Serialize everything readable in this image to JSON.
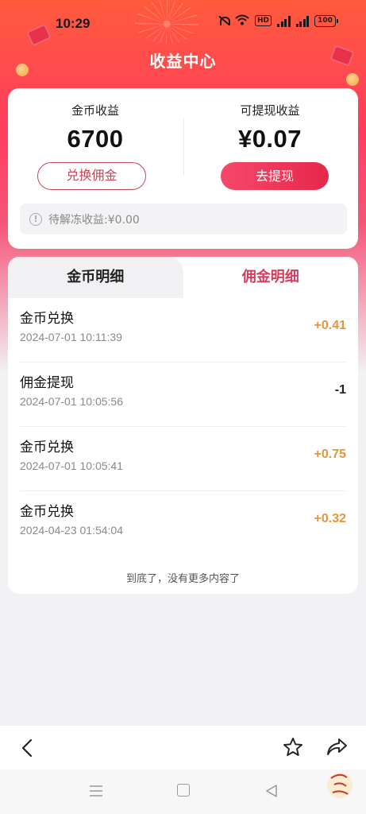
{
  "status_bar": {
    "time": "10:29",
    "battery": "100",
    "hd": "HD"
  },
  "header": {
    "title": "收益中心"
  },
  "earnings": {
    "coins_label": "金币收益",
    "coins_value": "6700",
    "exchange_button": "兑换佣金",
    "withdrawable_label": "可提现收益",
    "withdrawable_value": "¥0.07",
    "withdraw_button": "去提现",
    "frozen_text": "待解冻收益:¥0.00"
  },
  "tabs": [
    {
      "label": "金币明细",
      "active": false
    },
    {
      "label": "佣金明细",
      "active": true
    }
  ],
  "records": [
    {
      "title": "金币兑换",
      "time": "2024-07-01 10:11:39",
      "amount": "+0.41"
    },
    {
      "title": "佣金提现",
      "time": "2024-07-01 10:05:56",
      "amount": "-1"
    },
    {
      "title": "金币兑换",
      "time": "2024-07-01 10:05:41",
      "amount": "+0.75"
    },
    {
      "title": "金币兑换",
      "time": "2024-04-23 01:54:04",
      "amount": "+0.32"
    }
  ],
  "end_text": "到底了，没有更多内容了",
  "icons": {
    "back": "chevron-left-icon",
    "favorite": "star-icon",
    "share": "share-icon",
    "sys_menu": "menu-icon",
    "sys_home": "home-icon",
    "sys_back": "back-triangle-icon"
  },
  "colors": {
    "accent": "#d63c5c",
    "positive_amount": "#e8953a",
    "withdraw_button": "#e5284a",
    "hero_top": "#ff5a3c"
  }
}
